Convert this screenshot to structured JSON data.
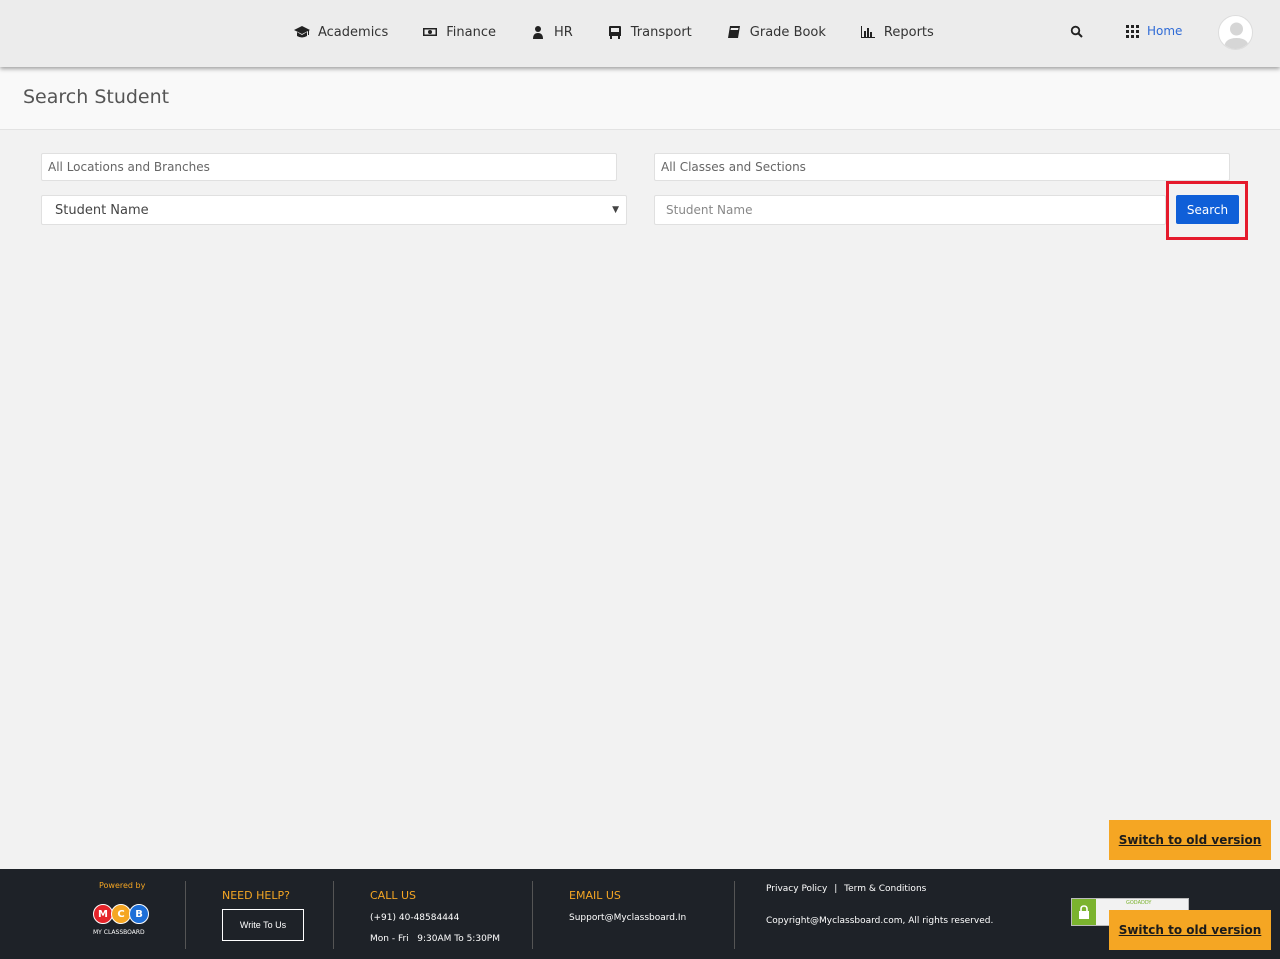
{
  "nav": {
    "items": [
      {
        "label": "Academics",
        "icon": "graduation-cap-icon"
      },
      {
        "label": "Finance",
        "icon": "money-icon"
      },
      {
        "label": "HR",
        "icon": "user-icon"
      },
      {
        "label": "Transport",
        "icon": "bus-icon"
      },
      {
        "label": "Grade Book",
        "icon": "book-icon"
      },
      {
        "label": "Reports",
        "icon": "bar-chart-icon"
      }
    ],
    "home_label": "Home"
  },
  "page": {
    "title": "Search Student"
  },
  "form": {
    "location_placeholder": "All Locations and Branches",
    "class_placeholder": "All Classes and Sections",
    "search_by_selected": "Student Name",
    "name_placeholder": "Student Name",
    "search_button": "Search"
  },
  "switch_label": "Switch to old version",
  "footer": {
    "powered_by": "Powered by",
    "logo_letters": [
      "M",
      "C",
      "B"
    ],
    "logo_colors": [
      "#e5242a",
      "#f5a623",
      "#1d6fd8"
    ],
    "logo_name": "MY CLASSBOARD",
    "help_heading": "NEED HELP?",
    "write_button": "Write To Us",
    "call_heading": "CALL US",
    "phone": "(+91) 40-48584444",
    "hours": "Mon - Fri   9:30AM To 5:30PM",
    "email_heading": "EMAIL US",
    "email": "Support@Myclassboard.In",
    "privacy": "Privacy Policy",
    "terms": "Term & Conditions",
    "copyright": "Copyright@Myclassboard.com, All rights reserved.",
    "badge_text": "GODADDY"
  },
  "colors": {
    "accent": "#0f5fd8",
    "orange": "#f5a623",
    "highlight": "#e51a2c"
  }
}
